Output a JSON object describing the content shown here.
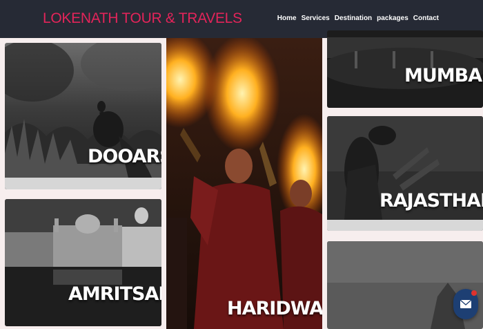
{
  "brand": {
    "title": "LOKENATH TOUR & TRAVELS"
  },
  "nav": {
    "items": [
      "Home",
      "Services",
      "Destination",
      "packages",
      "Contact"
    ]
  },
  "destinations": {
    "dooars": "DOOARS",
    "amritsar": "AMRITSAR",
    "haridwar": "HARIDWAR",
    "mumbai": "MUMBAI",
    "rajasthan": "RAJASTHAN"
  },
  "colors": {
    "navbar_bg": "#262a35",
    "brand_text": "#e3245a",
    "page_bg": "#f7eeee",
    "chat_button": "#1d3f73"
  },
  "icons": {
    "chat": "envelope-icon",
    "notification": "notification-dot"
  }
}
